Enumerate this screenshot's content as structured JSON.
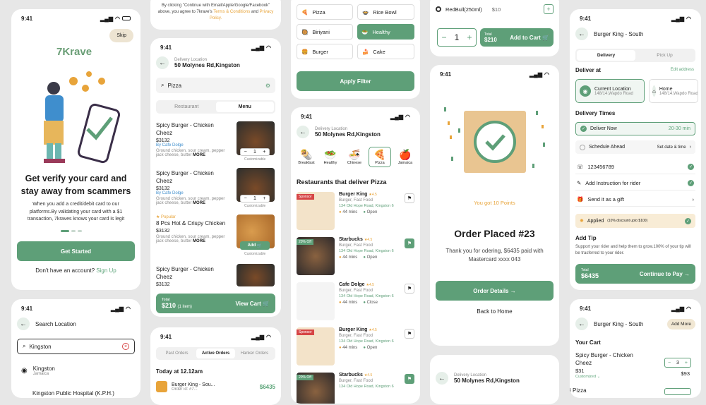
{
  "status": {
    "time": "9:41"
  },
  "s1": {
    "skip": "Skip",
    "logo": "7Krave",
    "title": "Get verify your card and stay away from scammers",
    "body": "When you add a credit/debit card to our platforms.By validating your card with a $1 transaction, 7kraves knows your card is legit",
    "cta": "Get Started",
    "account_q": "Don't have an account?",
    "signup": "Sign Up"
  },
  "s2": {
    "title": "Search Location",
    "query": "Kingston",
    "r1": "Kingston",
    "r1sub": "Jamaica",
    "r2": "Kingston Public Hospital (K.P.H.)"
  },
  "s3": {
    "terms_pre": "By clicking \"Continue with Email/Apple/Google/Facebook\" above, you agree to 7krave's",
    "terms_link": "Terms & Conditions",
    "terms_and": "and",
    "privacy": "Privacy Policy."
  },
  "s4": {
    "loc_label": "Delivery Location",
    "loc": "50 Molynes Rd,Kingston",
    "search": "Pizza",
    "tab1": "Restaurant",
    "tab2": "Menu",
    "items": [
      {
        "name": "Spicy Burger - Chicken Cheez",
        "price": "$3132",
        "by": "By Cafe Dolge",
        "desc": "Ground chicken, sour cream, pepper jack cheese, butter",
        "more": "MORE",
        "qty": "1",
        "cust": "Customizable"
      },
      {
        "name": "Spicy Burger - Chicken Cheez",
        "price": "$3132",
        "by": "By Cafe Dolge",
        "desc": "Ground chicken, sour cream, pepper jack cheese, butter",
        "more": "MORE",
        "qty": "1",
        "cust": "Customizable"
      },
      {
        "popular": "Popular",
        "name": "8 Pcs Hot & Crispy Chicken",
        "price": "$3132",
        "desc": "Ground chicken, sour cream, pepper jack cheese, butter",
        "more": "MORE",
        "add": "Add",
        "cust": "Customizable"
      },
      {
        "name": "Spicy Burger - Chicken Cheez",
        "price": "$3132"
      }
    ],
    "total_label": "Total",
    "total": "$210",
    "total_items": "(1 item)",
    "view_cart": "View Cart"
  },
  "s5": {
    "tabs": [
      "Past Orders",
      "Active Orders",
      "Hanker Orders"
    ],
    "today": "Today at 12.12am",
    "order_name": "Burger King - Sou...",
    "order_id": "Order id: #7...",
    "order_price": "$6435"
  },
  "s6": {
    "cats": [
      "Pizza",
      "Rice Bowl",
      "Biriyani",
      "Healthy",
      "Burger",
      "Cake"
    ],
    "apply": "Apply Filter"
  },
  "s7": {
    "loc_label": "Delivery Location",
    "loc": "50 Molynes Rd,Kingston",
    "cats": [
      "Breakfast",
      "Healthy",
      "Chinese",
      "Pizza",
      "Jamaica"
    ],
    "heading": "Restaurants that deliver Pizza",
    "rests": [
      {
        "name": "Burger King",
        "rating": "4.5",
        "type": "Burger, Fast Food",
        "addr": "134 Old Hope Road, Kingston 6",
        "time": "44 mins",
        "status": "Open",
        "tag": "Sponsor"
      },
      {
        "name": "Starbucks",
        "rating": "4.5",
        "type": "Burger, Fast Food",
        "addr": "134 Old Hope Road, Kingston 6",
        "time": "44 mins",
        "status": "Open",
        "tag": "20% Off"
      },
      {
        "name": "Cafe Dolge",
        "rating": "4.5",
        "type": "Burger, Fast Food",
        "addr": "134 Old Hope Road, Kingston 6",
        "time": "44 mins",
        "status": "Close",
        "tag": ""
      },
      {
        "name": "Burger King",
        "rating": "4.5",
        "type": "Burger, Fast Food",
        "addr": "134 Old Hope Road, Kingston 6",
        "time": "44 mins",
        "status": "Open",
        "tag": "Sponsor"
      },
      {
        "name": "Starbucks",
        "rating": "4.5",
        "type": "Burger, Fast Food",
        "addr": "134 Old Hope Road, Kingston 6",
        "tag": "20% Off"
      }
    ]
  },
  "s8": {
    "item": "RedBull(250ml)",
    "item_price": "$10",
    "qty": "1",
    "total_label": "Total",
    "total": "$210",
    "add_cart": "Add to Cart"
  },
  "s9": {
    "points": "You got 10 Points",
    "title": "Order Placed #23",
    "msg": "Thank you for odering, $6435 paid with Mastercard xxxx 043",
    "details": "Order Details",
    "home": "Back to Home"
  },
  "s10": {
    "loc_label": "Delivery Location",
    "loc": "50 Molynes Rd,Kingston"
  },
  "s11": {
    "title": "Burger King - South",
    "tab1": "Delivery",
    "tab2": "Pick Up",
    "deliver_at": "Deliver at",
    "edit": "Edit address",
    "addr1": "Current Location",
    "addr1sub": "148/14,Wapdo Road",
    "addr2": "Home",
    "addr2sub": "148/14,Wapdo Road",
    "times": "Delivery Times",
    "now": "Deliver Now",
    "now_time": "20-30 min",
    "sched": "Schedule Ahead",
    "sched_r": "Set date & time",
    "phone": "123456789",
    "instr": "Add Instruction for rider",
    "gift": "Send it as a gift",
    "applied": "Applied",
    "applied_sub": "(10% discount upto $100)",
    "tip_title": "Add Tip",
    "tip_body": "Support your rider and help them to grow.100% of your tip will be trasferred to your rider.",
    "total_label": "Total",
    "total": "$6435",
    "continue": "Continue to Pay"
  },
  "s12": {
    "title": "Burger King - South",
    "add_more": "Add More",
    "cart": "Your Cart",
    "item": "Spicy Burger - Chicken Cheez",
    "price": "$31",
    "cust": "Customized",
    "qty": "3",
    "line_total": "$93",
    "next": "i Pizza"
  },
  "colors": {
    "accent": "#5e9f78",
    "orange": "#e8a43a",
    "red": "#d64545"
  }
}
